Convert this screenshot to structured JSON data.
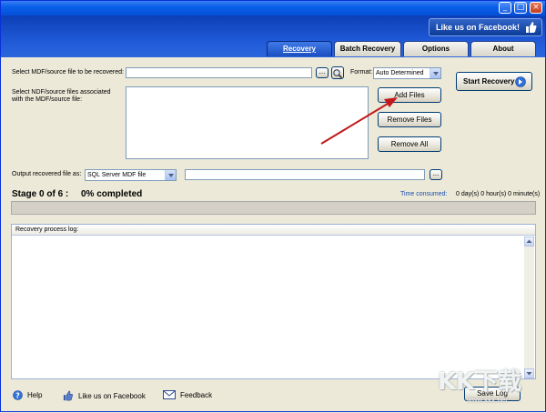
{
  "window": {
    "minimize_glyph": "_",
    "maximize_glyph": "□",
    "close_glyph": "×"
  },
  "banner": {
    "facebook_label": "Like us on Facebook!"
  },
  "tabs": [
    "Recovery",
    "Batch Recovery",
    "Options",
    "About"
  ],
  "recovery": {
    "mdf_label": "Select MDF/source file to be recovered:",
    "mdf_value": "",
    "browse_label": "...",
    "format_label": "Format:",
    "format_value": "Auto Determined",
    "assoc_label_line1": "Select NDF/source files associated",
    "assoc_label_line2": "with the MDF/source file:",
    "add_files_label": "Add Files",
    "remove_files_label": "Remove Files",
    "remove_all_label": "Remove All",
    "start_label": "Start Recovery",
    "output_label": "Output recovered file as:",
    "output_type": "SQL Server MDF file",
    "output_path": "",
    "output_browse_label": "..."
  },
  "status": {
    "stage": "Stage 0 of 6 :",
    "percent": "0% completed",
    "time_label": "Time consumed:",
    "time_value": "0 day(s) 0 hour(s) 0 minute(s)",
    "progress": 0
  },
  "log": {
    "title": "Recovery process log:"
  },
  "footer": {
    "help_label": "Help",
    "facebook_label": "Like us on Facebook",
    "feedback_label": "Feedback",
    "save_log_label": "Save Log"
  },
  "watermark": {
    "text": "KK下载",
    "url": "www.kkx.net"
  },
  "colors": {
    "title_blue": "#0a5fe8",
    "banner_blue": "#1f59d6",
    "active_tab": "#2b63d4",
    "arrow_red": "#c1191b"
  }
}
